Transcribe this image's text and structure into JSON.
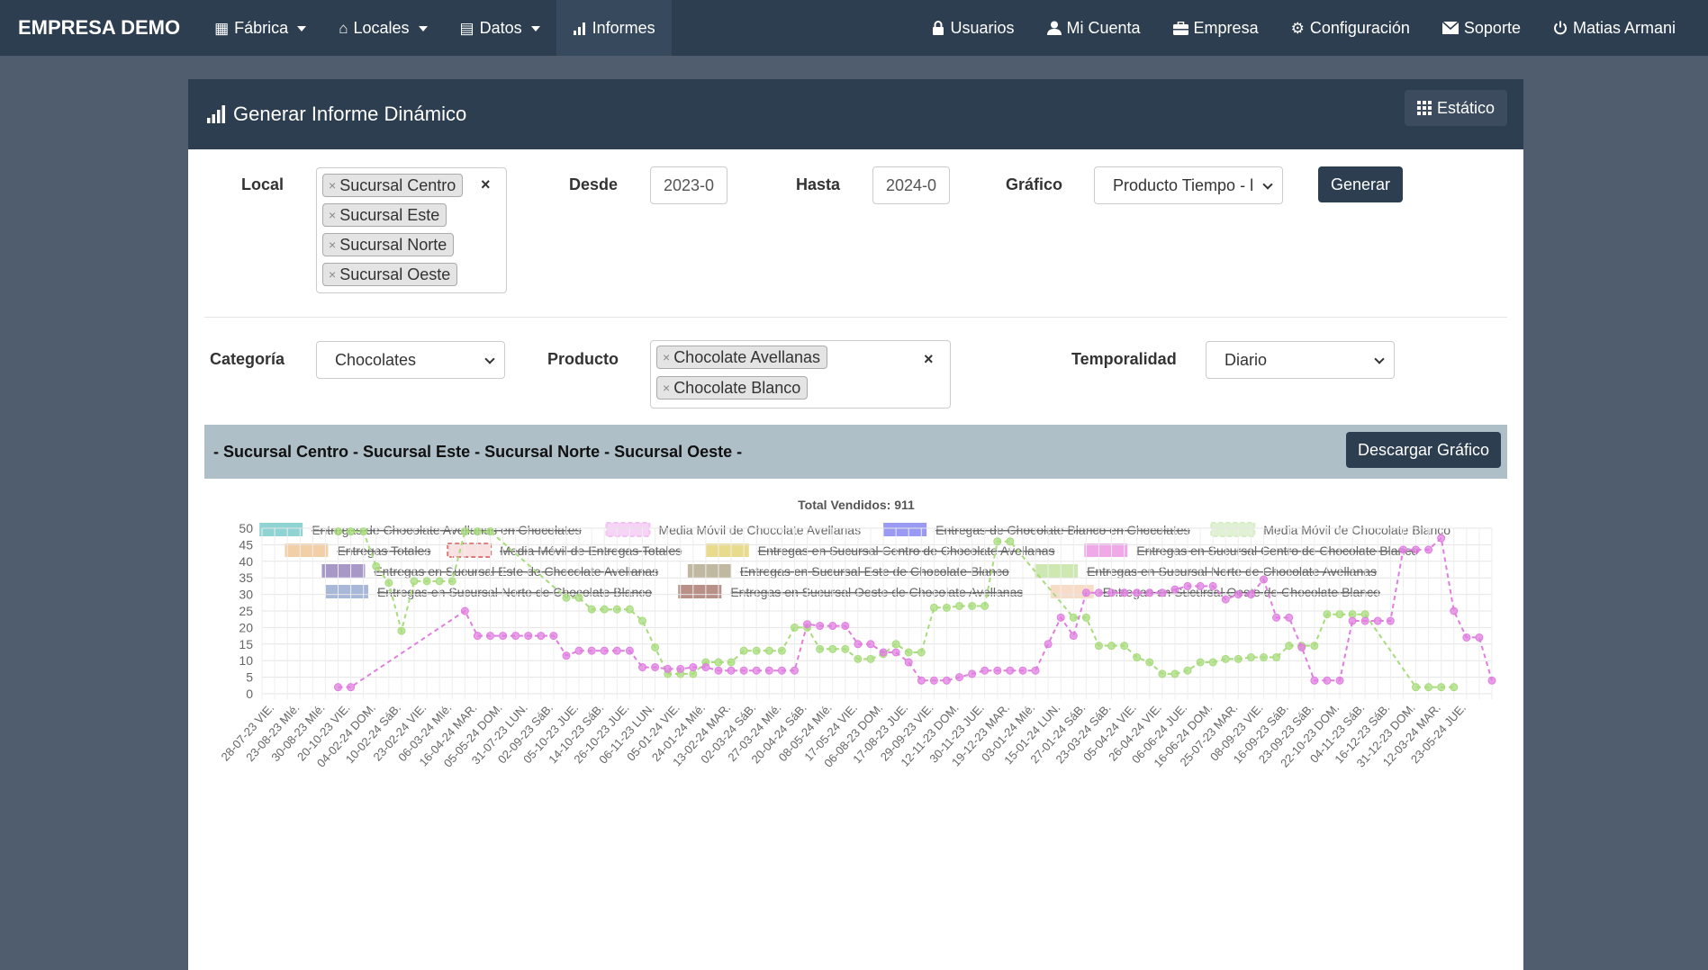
{
  "navbar": {
    "brand": "EMPRESA DEMO",
    "left": [
      {
        "label": "Fábrica",
        "icon": "table-icon"
      },
      {
        "label": "Locales",
        "icon": "home-icon"
      },
      {
        "label": "Datos",
        "icon": "hdd-icon"
      },
      {
        "label": "Informes",
        "icon": "bar-chart-icon"
      }
    ],
    "right": [
      {
        "label": "Usuarios",
        "icon": "lock-icon"
      },
      {
        "label": "Mi Cuenta",
        "icon": "user-icon"
      },
      {
        "label": "Empresa",
        "icon": "briefcase-icon"
      },
      {
        "label": "Configuración",
        "icon": "gear-icon"
      },
      {
        "label": "Soporte",
        "icon": "envelope-icon"
      },
      {
        "label": "Matias Armani",
        "icon": "power-icon"
      }
    ]
  },
  "card": {
    "title": "Generar Informe Dinámico",
    "static_button": "Estático"
  },
  "filters": {
    "local_label": "Local",
    "locales": [
      "Sucursal Centro",
      "Sucursal Este",
      "Sucursal Norte",
      "Sucursal Oeste"
    ],
    "desde_label": "Desde",
    "desde_value": "2023-0",
    "hasta_label": "Hasta",
    "hasta_value": "2024-0",
    "grafico_label": "Gráfico",
    "grafico_value": "Producto Tiempo - l",
    "generar": "Generar",
    "categoria_label": "Categoría",
    "categoria_value": "Chocolates",
    "producto_label": "Producto",
    "productos": [
      "Chocolate Avellanas",
      "Chocolate Blanco"
    ],
    "temporalidad_label": "Temporalidad",
    "temporalidad_value": "Diario",
    "clear": "×",
    "tag_remove": "×"
  },
  "banner": {
    "text": "- Sucursal Centro - Sucursal Este - Sucursal Norte - Sucursal Oeste -",
    "download": "Descargar Gráfico"
  },
  "colors": {
    "navbar": "#2c3e50",
    "green_series": "#a8dc7c",
    "pink_series": "#e07ee0"
  },
  "chart_data": {
    "type": "line",
    "title": "Total Vendidos: 911",
    "ylim": [
      0,
      50
    ],
    "yticks": [
      0,
      5,
      10,
      15,
      20,
      25,
      30,
      35,
      40,
      45,
      50
    ],
    "grid": true,
    "legend_placement": "top",
    "legend": [
      {
        "name": "Entregas de Chocolate Avellanas en Chocolates",
        "color": "#8fd3d3",
        "hidden": true,
        "dashed": false
      },
      {
        "name": "Media Móvil de Chocolate Avellanas",
        "color": "#f2b8f2",
        "hidden": false,
        "dashed": true
      },
      {
        "name": "Entregas de Chocolate Blanco en Chocolates",
        "color": "#9a9af5",
        "hidden": true,
        "dashed": false
      },
      {
        "name": "Media Móvil de Chocolate Blanco",
        "color": "#cde8b8",
        "hidden": false,
        "dashed": true
      },
      {
        "name": "Entregas Totales",
        "color": "#f2cfa6",
        "hidden": true,
        "dashed": false
      },
      {
        "name": "Media Móvil de Entregas Totales",
        "color": "#f4c4c4",
        "hidden": true,
        "dashed": true
      },
      {
        "name": "Entregas en Sucursal Centro de Chocolate Avellanas",
        "color": "#e8dc8c",
        "hidden": true,
        "dashed": false
      },
      {
        "name": "Entregas en Sucursal Centro de Chocolate Blanco",
        "color": "#f0a8e8",
        "hidden": true,
        "dashed": false
      },
      {
        "name": "Entregas en Sucursal Este de Chocolate Avellanas",
        "color": "#a898c8",
        "hidden": true,
        "dashed": false
      },
      {
        "name": "Entregas en Sucursal Este de Chocolate Blanco",
        "color": "#c0b8a0",
        "hidden": true,
        "dashed": false
      },
      {
        "name": "Entregas en Sucursal Norte de Chocolate Avellanas",
        "color": "#cde8b0",
        "hidden": true,
        "dashed": false
      },
      {
        "name": "Entregas en Sucursal Norte de Chocolate Blanco",
        "color": "#a8b8d8",
        "hidden": true,
        "dashed": false
      },
      {
        "name": "Entregas en Sucursal Oeste de Chocolate Avellanas",
        "color": "#b89088",
        "hidden": true,
        "dashed": false
      },
      {
        "name": "Entregas en Sucursal Oeste de Chocolate Blanco",
        "color": "#f8dcc8",
        "hidden": true,
        "dashed": false
      }
    ],
    "categories": [
      "28-07-23 VIE.",
      "23-08-23 MIé.",
      "30-08-23 MIé.",
      "20-10-23 VIE.",
      "04-02-24 DOM.",
      "10-02-24 SáB.",
      "23-02-24 VIE.",
      "06-03-24 MIé.",
      "16-04-24 MAR.",
      "05-05-24 DOM.",
      "31-07-23 LUN.",
      "02-09-23 SáB.",
      "05-10-23 JUE.",
      "14-10-23 SáB.",
      "26-10-23 JUE.",
      "06-11-23 LUN.",
      "05-01-24 VIE.",
      "24-01-24 MIé.",
      "13-02-24 MAR.",
      "02-03-24 SáB.",
      "27-03-24 MIé.",
      "20-04-24 SáB.",
      "08-05-24 MIé.",
      "17-05-24 VIE.",
      "06-08-23 DOM.",
      "17-08-23 JUE.",
      "29-09-23 VIE.",
      "12-11-23 DOM.",
      "30-11-23 JUE.",
      "19-12-23 MAR.",
      "03-01-24 MIé.",
      "15-01-24 LUN.",
      "27-01-24 SáB.",
      "23-03-24 SáB.",
      "05-04-24 VIE.",
      "26-04-24 VIE.",
      "06-06-24 JUE.",
      "16-06-24 DOM.",
      "25-07-23 MAR.",
      "08-09-23 VIE.",
      "16-09-23 SáB.",
      "23-09-23 SáB.",
      "22-10-23 DOM.",
      "04-11-23 SáB.",
      "16-12-23 SáB.",
      "31-12-23 DOM.",
      "12-03-24 MAR.",
      "23-05-24 JUE."
    ],
    "series": [
      {
        "name": "Media Móvil de Chocolate Blanco",
        "color": "#a8dc7c",
        "points": [
          [
            6,
            49
          ],
          [
            7,
            49
          ],
          [
            8,
            49
          ],
          [
            9,
            38.5
          ],
          [
            10,
            33.5
          ],
          [
            11,
            19
          ],
          [
            12,
            34
          ],
          [
            13,
            34
          ],
          [
            14,
            34
          ],
          [
            15,
            34
          ],
          [
            16,
            49
          ],
          [
            17,
            49
          ],
          [
            18,
            49
          ],
          [
            24,
            29
          ],
          [
            25,
            29
          ],
          [
            26,
            25.5
          ],
          [
            27,
            25.5
          ],
          [
            28,
            25.5
          ],
          [
            29,
            25.5
          ],
          [
            30,
            22
          ],
          [
            31,
            14
          ],
          [
            32,
            6
          ],
          [
            33,
            6
          ],
          [
            34,
            6
          ],
          [
            35,
            9.5
          ],
          [
            36,
            9.5
          ],
          [
            37,
            9.5
          ],
          [
            38,
            13
          ],
          [
            39,
            13
          ],
          [
            40,
            13
          ],
          [
            41,
            13
          ],
          [
            42,
            20
          ],
          [
            43,
            20
          ],
          [
            44,
            13.5
          ],
          [
            45,
            13.5
          ],
          [
            46,
            13.5
          ],
          [
            47,
            10.5
          ],
          [
            48,
            10.5
          ],
          [
            49,
            12
          ],
          [
            50,
            15
          ],
          [
            51,
            12.5
          ],
          [
            52,
            12.5
          ],
          [
            53,
            26
          ],
          [
            54,
            26
          ],
          [
            55,
            26.5
          ],
          [
            56,
            26.5
          ],
          [
            57,
            26.5
          ],
          [
            58,
            46
          ],
          [
            59,
            46
          ],
          [
            64,
            23
          ],
          [
            65,
            23
          ],
          [
            66,
            14.5
          ],
          [
            67,
            14.5
          ],
          [
            68,
            14.5
          ],
          [
            69,
            11
          ],
          [
            70,
            9.5
          ],
          [
            71,
            6
          ],
          [
            72,
            6
          ],
          [
            73,
            7
          ],
          [
            74,
            9.5
          ],
          [
            75,
            9.5
          ],
          [
            76,
            10.5
          ],
          [
            77,
            10.5
          ],
          [
            78,
            11
          ],
          [
            79,
            11
          ],
          [
            80,
            11
          ],
          [
            81,
            14.5
          ],
          [
            82,
            14.5
          ],
          [
            83,
            14.5
          ],
          [
            84,
            24
          ],
          [
            85,
            24
          ],
          [
            86,
            24
          ],
          [
            87,
            24
          ],
          [
            91,
            2
          ],
          [
            92,
            2
          ],
          [
            93,
            2
          ],
          [
            94,
            2
          ]
        ]
      },
      {
        "name": "Media Móvil de Chocolate Avellanas",
        "color": "#e07ee0",
        "points": [
          [
            6,
            2
          ],
          [
            7,
            2
          ],
          [
            16,
            25
          ],
          [
            17,
            17.5
          ],
          [
            18,
            17.5
          ],
          [
            19,
            17.5
          ],
          [
            20,
            17.5
          ],
          [
            21,
            17.5
          ],
          [
            22,
            17.5
          ],
          [
            23,
            17.5
          ],
          [
            24,
            11.5
          ],
          [
            25,
            13
          ],
          [
            26,
            13
          ],
          [
            27,
            13
          ],
          [
            28,
            13
          ],
          [
            29,
            13
          ],
          [
            30,
            8
          ],
          [
            31,
            8
          ],
          [
            32,
            7.5
          ],
          [
            33,
            7.5
          ],
          [
            34,
            8
          ],
          [
            35,
            8
          ],
          [
            36,
            7
          ],
          [
            37,
            7
          ],
          [
            38,
            7
          ],
          [
            39,
            7
          ],
          [
            40,
            7
          ],
          [
            41,
            7
          ],
          [
            42,
            7
          ],
          [
            43,
            21
          ],
          [
            44,
            20.5
          ],
          [
            45,
            20.5
          ],
          [
            46,
            20.5
          ],
          [
            47,
            15
          ],
          [
            48,
            15
          ],
          [
            49,
            12.5
          ],
          [
            50,
            12.5
          ],
          [
            51,
            9.5
          ],
          [
            52,
            4
          ],
          [
            53,
            4
          ],
          [
            54,
            4
          ],
          [
            55,
            5
          ],
          [
            56,
            6
          ],
          [
            57,
            7
          ],
          [
            58,
            7
          ],
          [
            59,
            7
          ],
          [
            60,
            7
          ],
          [
            61,
            7
          ],
          [
            62,
            15
          ],
          [
            63,
            23
          ],
          [
            64,
            17.5
          ],
          [
            65,
            30.5
          ],
          [
            66,
            30.5
          ],
          [
            67,
            30.5
          ],
          [
            68,
            30.5
          ],
          [
            69,
            30.5
          ],
          [
            70,
            30.5
          ],
          [
            71,
            30.5
          ],
          [
            72,
            31.5
          ],
          [
            73,
            32.5
          ],
          [
            74,
            32.5
          ],
          [
            75,
            32.5
          ],
          [
            76,
            28.5
          ],
          [
            77,
            30
          ],
          [
            78,
            30
          ],
          [
            79,
            34.5
          ],
          [
            80,
            23
          ],
          [
            81,
            23
          ],
          [
            82,
            14
          ],
          [
            83,
            4
          ],
          [
            84,
            4
          ],
          [
            85,
            4
          ],
          [
            86,
            22
          ],
          [
            87,
            22
          ],
          [
            88,
            22
          ],
          [
            89,
            22
          ],
          [
            90,
            43.5
          ],
          [
            91,
            43.5
          ],
          [
            92,
            43.5
          ],
          [
            93,
            47
          ],
          [
            94,
            25
          ],
          [
            95,
            17
          ],
          [
            96,
            17
          ],
          [
            97,
            4
          ]
        ]
      }
    ]
  }
}
